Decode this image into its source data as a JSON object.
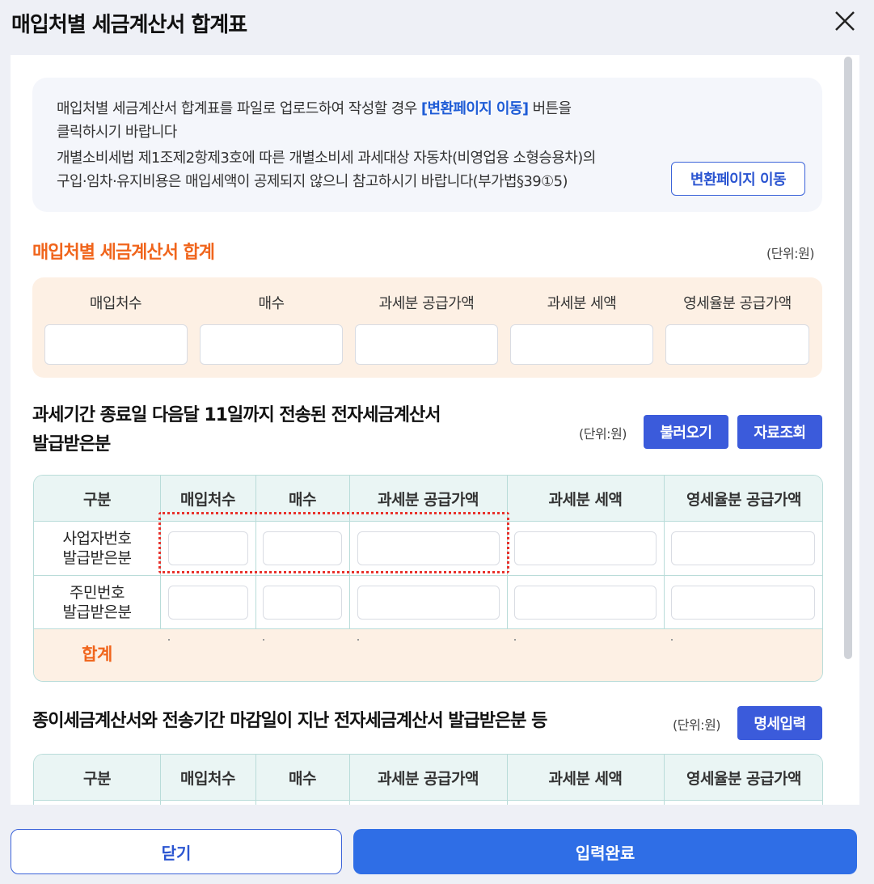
{
  "modal": {
    "title": "매입처별 세금계산서 합계표"
  },
  "notice": {
    "line1_prefix": "매입처별 세금계산서 합계표를 파일로 업로드하여 작성할 경우 ",
    "line1_link": "[변환페이지 이동]",
    "line1_suffix": " 버튼을",
    "line2": "클릭하시기 바랍니다",
    "line3": "개별소비세법 제1조제2항제3호에 따른 개별소비세 과세대상 자동차(비영업용 소형승용차)의",
    "line4": "구입·임차·유지비용은 매입세액이 공제되지 않으니 참고하시기 바랍니다(부가법§39①5)",
    "convert_button": "변환페이지 이동"
  },
  "summary": {
    "title": "매입처별 세금계산서 합계",
    "unit": "(단위:원)",
    "headers": [
      "매입처수",
      "매수",
      "과세분 공급가액",
      "과세분 세액",
      "영세율분 공급가액"
    ]
  },
  "section2": {
    "title_line1": "과세기간 종료일 다음달 11일까지 전송된 전자세금계산서",
    "title_line2": "발급받은분",
    "unit": "(단위:원)",
    "load_button": "불러오기",
    "lookup_button": "자료조회",
    "headers": [
      "구분",
      "매입처수",
      "매수",
      "과세분 공급가액",
      "과세분 세액",
      "영세율분 공급가액"
    ],
    "row1_label_a": "사업자번호",
    "row1_label_b": "발급받은분",
    "row2_label_a": "주민번호",
    "row2_label_b": "발급받은분",
    "total_label": "합계"
  },
  "section3": {
    "title": "종이세금계산서와 전송기간 마감일이 지난 전자세금계산서 발급받은분 등",
    "unit": "(단위:원)",
    "detail_button": "명세입력",
    "headers": [
      "구분",
      "매입처수",
      "매수",
      "과세분 공급가액",
      "과세분 세액",
      "영세율분 공급가액"
    ]
  },
  "footer": {
    "close_button": "닫기",
    "done_button": "입력완료"
  }
}
